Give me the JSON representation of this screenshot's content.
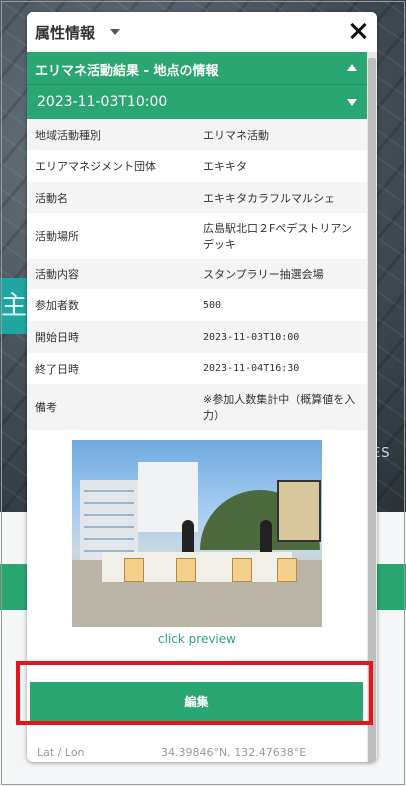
{
  "panel": {
    "title": "属性情報",
    "section_title": "エリマネ活動結果 - 地点の情報",
    "date_header": "2023-11-03T10:00",
    "preview_label": "click preview",
    "edit_button": "編集",
    "latlon_label": "Lat / Lon",
    "latlon_value": "34.39846°N, 132.47638°E"
  },
  "attributes": [
    {
      "key": "地域活動種別",
      "value": "エリマネ活動"
    },
    {
      "key": "エリアマネジメント団体",
      "value": "エキキタ"
    },
    {
      "key": "活動名",
      "value": "エキキタカラフルマルシェ"
    },
    {
      "key": "活動場所",
      "value": "広島駅北口２Fペデストリアンデッキ"
    },
    {
      "key": "活動内容",
      "value": "スタンプラリー抽選会場"
    },
    {
      "key": "参加者数",
      "value": "500"
    },
    {
      "key": "開始日時",
      "value": "2023-11-03T10:00"
    },
    {
      "key": "終了日時",
      "value": "2023-11-04T16:30"
    },
    {
      "key": "備考",
      "value": "※参加人数集計中（概算値を入力）"
    }
  ],
  "background": {
    "left_glyph": "主",
    "right_text": "ES"
  },
  "colors": {
    "accent": "#2aa673",
    "highlight": "#e3141c"
  }
}
